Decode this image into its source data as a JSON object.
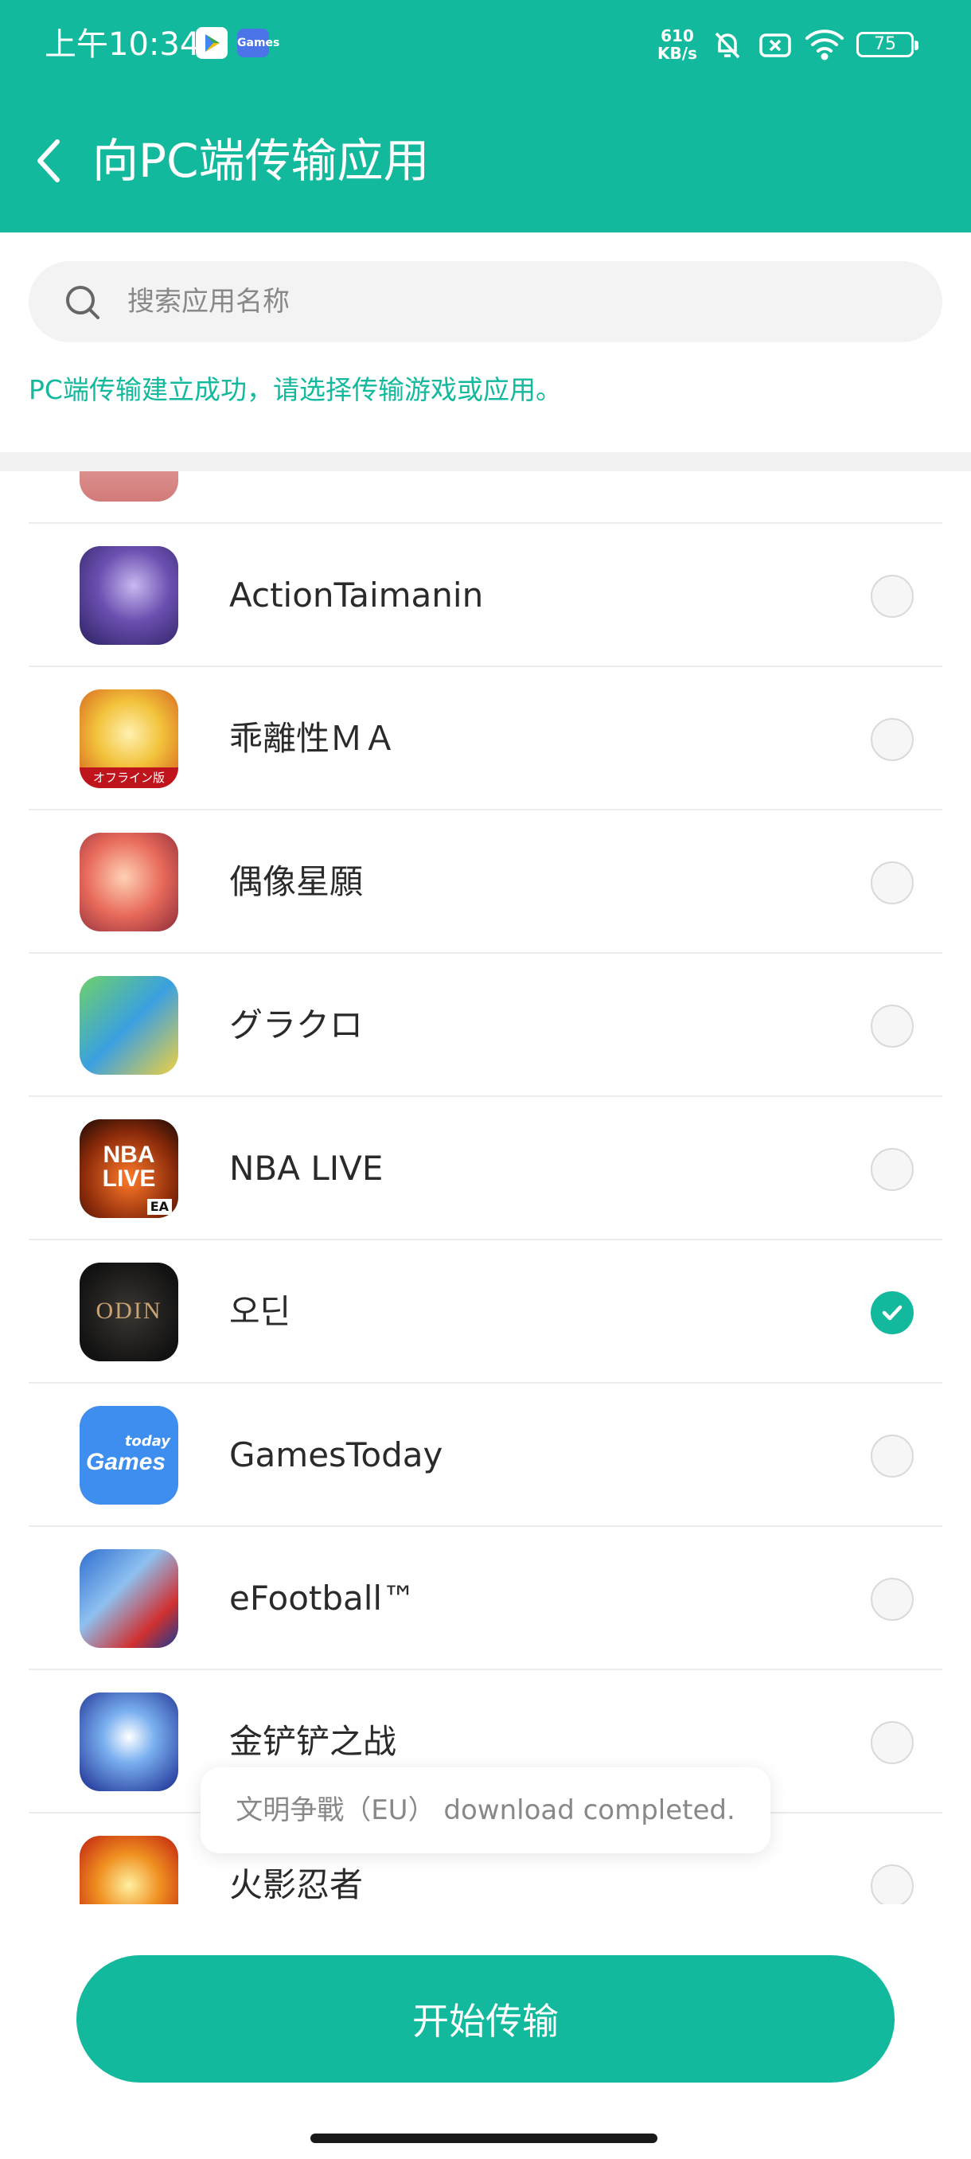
{
  "status_bar": {
    "time": "上午10:34",
    "speed_top": "610",
    "speed_bottom": "KB/s",
    "battery": "75"
  },
  "header": {
    "title": "向PC端传输应用"
  },
  "search": {
    "placeholder": "搜索应用名称"
  },
  "hint": "PC端传输建立成功，请选择传输游戏或应用。",
  "apps": [
    {
      "name": "",
      "icon": "partial-app-icon",
      "checked": false
    },
    {
      "name": "ActionTaimanin",
      "icon": "action-taimanin-icon",
      "checked": false
    },
    {
      "name": "乖離性ＭＡ",
      "icon": "kairisei-ma-icon",
      "checked": false
    },
    {
      "name": "偶像星願",
      "icon": "idol-wish-icon",
      "checked": false
    },
    {
      "name": "グラクロ",
      "icon": "gurakuro-icon",
      "checked": false
    },
    {
      "name": "NBA LIVE",
      "icon": "nba-live-icon",
      "checked": false
    },
    {
      "name": "오딘",
      "icon": "odin-icon",
      "checked": true
    },
    {
      "name": "GamesToday",
      "icon": "gamestoday-icon",
      "checked": false
    },
    {
      "name": "eFootball™",
      "icon": "efootball-icon",
      "checked": false
    },
    {
      "name": "金铲铲之战",
      "icon": "jinchanchan-icon",
      "checked": false
    },
    {
      "name": "火影忍者",
      "icon": "naruto-icon",
      "checked": false
    }
  ],
  "icon_text": {
    "ma_badge": "オフライン版",
    "nba_line1": "NBA",
    "nba_line2": "LIVE",
    "nba_ea": "EA",
    "odin_logo": "ODIN",
    "games_small": "today",
    "games_big": "Games",
    "status_games": "Games"
  },
  "toast": "文明争戰（EU） download completed.",
  "start_button": "开始传输",
  "colors": {
    "primary": "#13b99c",
    "toast_text": "#888888"
  }
}
